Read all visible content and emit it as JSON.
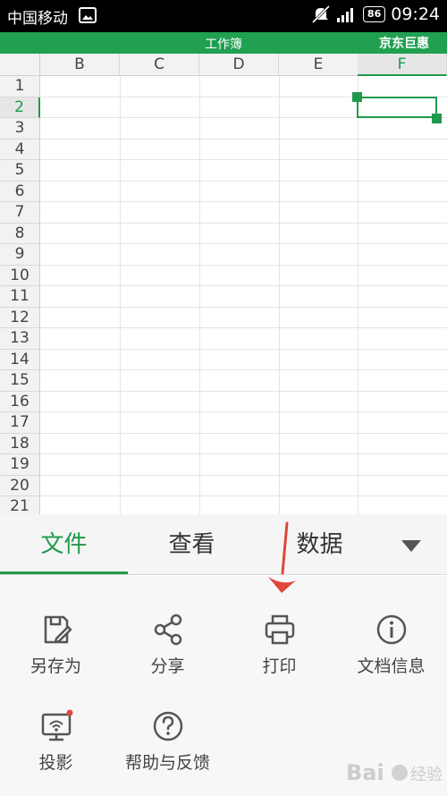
{
  "status_bar": {
    "carrier": "中国移动",
    "battery": "86",
    "time": "09:24"
  },
  "title_bar": {
    "title": "工作簿",
    "promo": "京东巨惠"
  },
  "sheet": {
    "columns": [
      "B",
      "C",
      "D",
      "E",
      "F"
    ],
    "rows": [
      "1",
      "2",
      "3",
      "4",
      "5",
      "6",
      "7",
      "8",
      "9",
      "10",
      "11",
      "12",
      "13",
      "14",
      "15",
      "16",
      "17",
      "18",
      "19",
      "20",
      "21"
    ],
    "active_column": "F",
    "active_row": "2"
  },
  "tabs": [
    {
      "label": "文件",
      "active": true
    },
    {
      "label": "查看",
      "active": false
    },
    {
      "label": "数据",
      "active": false
    }
  ],
  "actions": [
    {
      "label": "另存为",
      "icon": "save-as-icon"
    },
    {
      "label": "分享",
      "icon": "share-icon"
    },
    {
      "label": "打印",
      "icon": "print-icon"
    },
    {
      "label": "文档信息",
      "icon": "info-icon"
    },
    {
      "label": "投影",
      "icon": "projection-icon"
    },
    {
      "label": "帮助与反馈",
      "icon": "help-icon"
    }
  ],
  "colors": {
    "accent": "#1f9a4c",
    "title_bar": "#20a050",
    "annotation_arrow": "#e0463a"
  }
}
